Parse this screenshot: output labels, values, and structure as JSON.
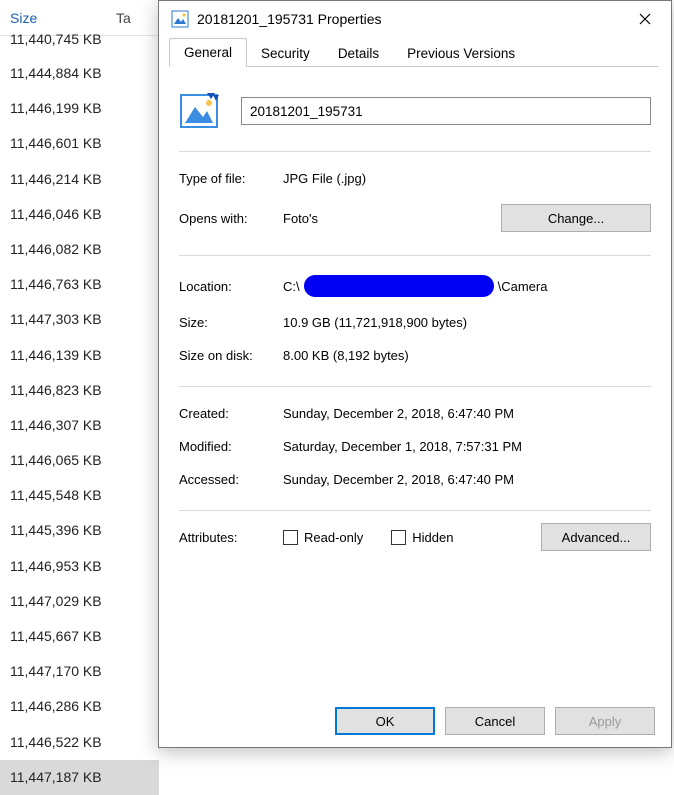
{
  "explorer": {
    "columns": {
      "size": "Size",
      "ta": "Ta"
    },
    "partial_row": "11,440,745 KB",
    "rows": [
      "11,444,884 KB",
      "11,446,199 KB",
      "11,446,601 KB",
      "11,446,214 KB",
      "11,446,046 KB",
      "11,446,082 KB",
      "11,446,763 KB",
      "11,447,303 KB",
      "11,446,139 KB",
      "11,446,823 KB",
      "11,446,307 KB",
      "11,446,065 KB",
      "11,445,548 KB",
      "11,445,396 KB",
      "11,446,953 KB",
      "11,447,029 KB",
      "11,445,667 KB",
      "11,447,170 KB",
      "11,446,286 KB",
      "11,446,522 KB",
      "11,447,187 KB"
    ],
    "selected_index": 20
  },
  "dialog": {
    "title": "20181201_195731 Properties",
    "tabs": [
      "General",
      "Security",
      "Details",
      "Previous Versions"
    ],
    "active_tab": 0,
    "filename": "20181201_195731",
    "labels": {
      "type_of_file": "Type of file:",
      "opens_with": "Opens with:",
      "change": "Change...",
      "location": "Location:",
      "size": "Size:",
      "size_on_disk": "Size on disk:",
      "created": "Created:",
      "modified": "Modified:",
      "accessed": "Accessed:",
      "attributes": "Attributes:",
      "read_only": "Read-only",
      "hidden": "Hidden",
      "advanced": "Advanced..."
    },
    "values": {
      "type_of_file": "JPG File (.jpg)",
      "opens_with": "Foto's",
      "location_prefix": "C:\\",
      "location_suffix": "\\Camera",
      "size": "10.9 GB (11,721,918,900 bytes)",
      "size_on_disk": "8.00 KB (8,192 bytes)",
      "created": "Sunday, December 2, 2018, 6:47:40 PM",
      "modified": "Saturday, December 1, 2018, 7:57:31 PM",
      "accessed": "Sunday, December 2, 2018, 6:47:40 PM"
    },
    "buttons": {
      "ok": "OK",
      "cancel": "Cancel",
      "apply": "Apply"
    }
  }
}
